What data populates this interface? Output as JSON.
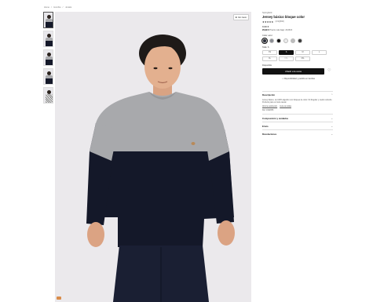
{
  "breadcrumb": [
    "Home",
    "Hombre",
    "Jerséis"
  ],
  "gallery": {
    "zoom_label": "Ver zoom",
    "thumbnails": [
      {
        "kind": "model",
        "active": true
      },
      {
        "kind": "model",
        "active": false
      },
      {
        "kind": "model",
        "active": false
      },
      {
        "kind": "model",
        "active": false
      },
      {
        "kind": "pattern",
        "active": false
      }
    ]
  },
  "product": {
    "brand": "Springfield",
    "title": "Jersey básico bloque color",
    "stars": "★★★★★",
    "reviews": "(4.9)(602)",
    "price": "9,99 €",
    "old_price_note": "29,99 €",
    "old_price_strike": "Precio más bajo: 29,99 €"
  },
  "colors": {
    "label": "Color: azul",
    "swatches": [
      {
        "color": "#2b2f3a",
        "active": true
      },
      {
        "color": "#8a8d93",
        "active": false
      },
      {
        "color": "#111111",
        "active": false
      },
      {
        "color": "#ececec",
        "active": false
      },
      {
        "color": "#bdbdbd",
        "active": false
      },
      {
        "color": "#3a3a3a",
        "active": false
      }
    ]
  },
  "sizes": {
    "label": "Talla: S",
    "options": [
      {
        "label": "XS",
        "state": "normal"
      },
      {
        "label": "S",
        "state": "selected"
      },
      {
        "label": "M",
        "state": "normal"
      },
      {
        "label": "L",
        "state": "normal"
      },
      {
        "label": "XL",
        "state": "normal"
      },
      {
        "label": "XXL",
        "state": "disabled"
      },
      {
        "label": "3XL",
        "state": "normal"
      }
    ]
  },
  "stock_label": "Disponible",
  "add_to_cart": "Añadir a la cesta",
  "store_link": "Disponibilidad y pedido en tiendas",
  "accordion": [
    {
      "title": "Descripción",
      "open": true,
      "body": "Jersey básico, de 100% algodón con bloques de color. Fit Regular y cuello redondo. Perfecto para un look casual.",
      "links": [
        "Ahorra sustitución",
        "Guía de tallas"
      ],
      "ref": "Ref. 1942053"
    },
    {
      "title": "Composición y cuidados",
      "open": false
    },
    {
      "title": "Envío",
      "open": false
    },
    {
      "title": "Devoluciones",
      "open": false
    }
  ]
}
